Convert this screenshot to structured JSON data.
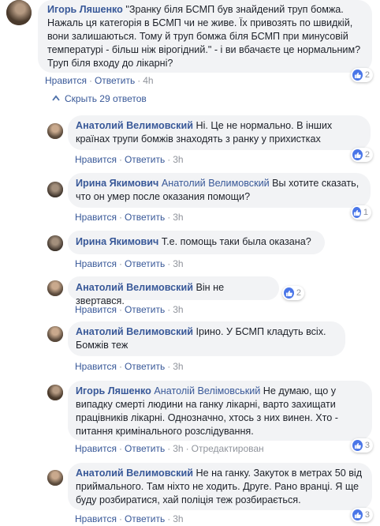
{
  "root": {
    "author": "Игорь Ляшенко",
    "text": "\"Зранку біля БСМП був знайдений труп бомжа. Нажаль ця категорія в БСМП чи не живе. Їх привозять по швидкій, вони залишаються. Тому й труп бомжа біля БСМП при минусовій температурі - більш ніж вірогідний.\" - і ви вбачаєте це нормальним? Труп біля входу до лікарні?",
    "like": "Нравится",
    "reply": "Ответить",
    "time": "4h",
    "reactions": "2"
  },
  "hide_replies_label": "Скрыть 29 ответов",
  "replies": [
    {
      "author": "Анатолий Велимовский",
      "mention": "",
      "text": "Ні. Це не нормально. В інших країнах трупи бомжів знаходять з ранку у прихистках",
      "like": "Нравится",
      "reply": "Ответить",
      "time": "3h",
      "extra": "",
      "reactions": "2"
    },
    {
      "author": "Ирина Якимович",
      "mention": "Анатолий Велимовский",
      "text": "Вы хотите сказать, что он умер после оказания помощи?",
      "like": "Нравится",
      "reply": "Ответить",
      "time": "3h",
      "extra": "",
      "reactions": "1"
    },
    {
      "author": "Ирина Якимович",
      "mention": "",
      "text": "Т.е. помощь таки была оказана?",
      "like": "Нравится",
      "reply": "Ответить",
      "time": "3h",
      "extra": "",
      "reactions": ""
    },
    {
      "author": "Анатолий Велимовский",
      "mention": "",
      "text": "Він не звертався.",
      "like": "Нравится",
      "reply": "Ответить",
      "time": "3h",
      "extra": "",
      "reactions": "2"
    },
    {
      "author": "Анатолий Велимовский",
      "mention": "",
      "text": "Ірино. У БСМП кладуть всіх. Бомжів теж",
      "like": "Нравится",
      "reply": "Ответить",
      "time": "3h",
      "extra": "",
      "reactions": ""
    },
    {
      "author": "Игорь Ляшенко",
      "mention": "Анатолій Велімовський",
      "text": "Не думаю, що у випадку смерті людини на ганку лікарні, варто захищати працівників лікарні. Однозначно, хтось з них винен. Хто - питання кримінального розслідування.",
      "like": "Нравится",
      "reply": "Ответить",
      "time": "3h",
      "extra": "Отредактирован",
      "reactions": "3"
    },
    {
      "author": "Анатолий Велимовский",
      "mention": "",
      "text": "Не на ганку. Закуток в метрах 50 від приймального. Там ніхто не ходить. Друге. Рано вранці. Я ще буду розбиратися, хай поліція теж розбирається.",
      "like": "Нравится",
      "reply": "Ответить",
      "time": "3h",
      "extra": "",
      "reactions": "3"
    }
  ],
  "colors": {
    "link": "#385898",
    "bubble": "#f2f3f5",
    "like_blue": "#4a76e8",
    "meta": "#90949c"
  }
}
